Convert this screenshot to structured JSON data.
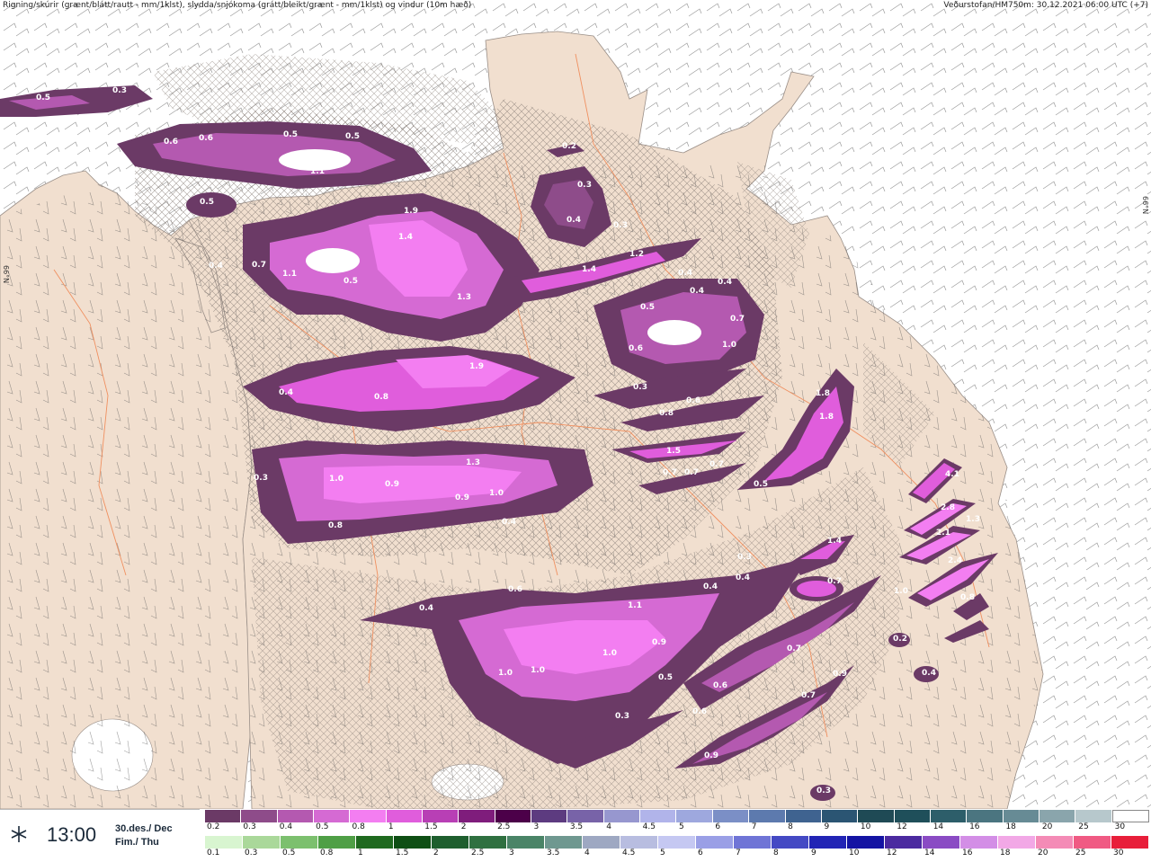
{
  "header": {
    "left": "Rigning/skúrir (grænt/blátt/rautt - mm/1klst), slydda/snjókoma (grátt/bleikt/grænt - mm/1klst) og vindur (10m hæð)",
    "right": "Veðurstofan/HM750m: 30.12.2021 06:00 UTC (+7)"
  },
  "grid_labels": {
    "left": "66°N",
    "right": "66°N"
  },
  "time_box": {
    "time": "13:00",
    "date_line1": "30.des./ Dec",
    "date_line2": "Fim./ Thu",
    "icon": "snowflake-wind-icon"
  },
  "colors": {
    "sea": "#ffffff",
    "land": "#f1dfcf",
    "snow_dark": "#6b3a66",
    "snow_mid": "#a54fa0",
    "snow_bright": "#e27ee5",
    "snow_hot": "#f59ef5"
  },
  "legend": {
    "snow_labels": [
      "0.2",
      "0.3",
      "0.4",
      "0.5",
      "0.8",
      "1",
      "1.5",
      "2",
      "2.5",
      "3",
      "3.5",
      "4",
      "4.5",
      "5",
      "6",
      "7",
      "8",
      "9",
      "10",
      "12",
      "14",
      "16",
      "18",
      "20",
      "25",
      "30"
    ],
    "snow_colors": [
      "#6b3a66",
      "#8e4c8a",
      "#b459b0",
      "#d56ad3",
      "#f37ef1",
      "#e05ddc",
      "#b83fb5",
      "#7f1d7c",
      "#4c0049",
      "#5d3b80",
      "#7863a8",
      "#9797cf",
      "#b1b4ea",
      "#9ea8de",
      "#7b8fc6",
      "#5d7aae",
      "#3f6390",
      "#2b5573",
      "#1f4a55",
      "#1f4f5a",
      "#2d5e6a",
      "#4b7580",
      "#678b95",
      "#8aa5ac",
      "#b7c8cc",
      "#ffffff"
    ],
    "rain_labels": [
      "0.1",
      "0.3",
      "0.5",
      "0.8",
      "1",
      "1.5",
      "2",
      "2.5",
      "3",
      "3.5",
      "4",
      "4.5",
      "5",
      "6",
      "7",
      "8",
      "9",
      "10",
      "12",
      "14",
      "16",
      "18",
      "20",
      "25",
      "30"
    ],
    "rain_colors": [
      "#d8f5d0",
      "#aad89a",
      "#7cc06e",
      "#4f9f46",
      "#1f6a1f",
      "#0e4f14",
      "#1e5f2e",
      "#2f7040",
      "#4a8467",
      "#6f9890",
      "#9ea8c2",
      "#b8bde0",
      "#c5c8f2",
      "#9a9fe6",
      "#6f74d6",
      "#4449c4",
      "#2224b5",
      "#1413a3",
      "#4b2aa0",
      "#8a4bc4",
      "#d38ee6",
      "#f2a8e6",
      "#f48bb6",
      "#f05a83",
      "#e81e3a"
    ]
  },
  "map_values": [
    "0.5",
    "0.3",
    "0.6",
    "0.6",
    "0.5",
    "0.5",
    "1.1",
    "0.5",
    "1.9",
    "1.4",
    "0.4",
    "0.7",
    "1.1",
    "0.5",
    "1.3",
    "0.2",
    "0.3",
    "0.4",
    "0.3",
    "1.2",
    "1.4",
    "0.4",
    "0.4",
    "0.4",
    "0.5",
    "0.7",
    "0.6",
    "1.0",
    "1.9",
    "0.4",
    "0.8",
    "0.3",
    "0.8",
    "0.6",
    "1.8",
    "1.8",
    "1.5",
    "0.3",
    "1.3",
    "1.0",
    "0.9",
    "0.9",
    "1.0",
    "0.8",
    "0.4",
    "0.7",
    "0.7",
    "0.7",
    "0.5",
    "1.4",
    "0.3",
    "0.4",
    "0.4",
    "0.7",
    "0.6",
    "1.1",
    "0.4",
    "1.0",
    "0.9",
    "1.0",
    "1.0",
    "0.5",
    "0.7",
    "0.3",
    "0.6",
    "0.7",
    "0.6",
    "0.9",
    "0.9",
    "4.1",
    "2.8",
    "2.1",
    "1.3",
    "2.4",
    "1.0",
    "0.8",
    "0.2",
    "0.4",
    "0.3"
  ]
}
